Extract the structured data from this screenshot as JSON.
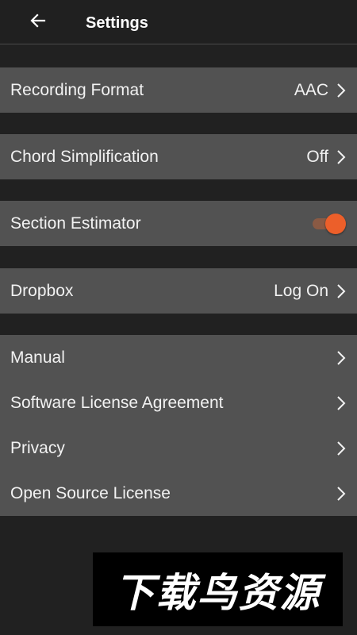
{
  "header": {
    "title": "Settings",
    "back_icon": "arrow-left-icon"
  },
  "settings": {
    "recording_format": {
      "label": "Recording Format",
      "value": "AAC"
    },
    "chord_simplification": {
      "label": "Chord Simplification",
      "value": "Off"
    },
    "section_estimator": {
      "label": "Section Estimator",
      "enabled": true
    },
    "dropbox": {
      "label": "Dropbox",
      "value": "Log On"
    },
    "info": [
      {
        "label": "Manual"
      },
      {
        "label": "Software License Agreement"
      },
      {
        "label": "Privacy"
      },
      {
        "label": "Open Source License"
      }
    ]
  },
  "watermark": {
    "text": "下载鸟资源"
  },
  "colors": {
    "background": "#212121",
    "row_background": "#525252",
    "accent": "#ec5f2a",
    "toggle_track": "#8a5a44"
  }
}
